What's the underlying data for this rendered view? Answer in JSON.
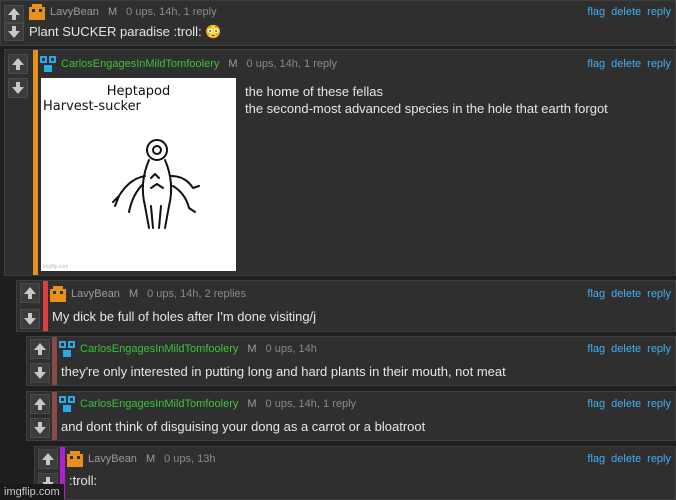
{
  "actions": {
    "flag": "flag",
    "delete": "delete",
    "reply": "reply"
  },
  "comments": [
    {
      "user": "LavyBean",
      "mod": "M",
      "meta": "0 ups, 14h, 1 reply",
      "text": "Plant SUCKER paradise :troll: 😳"
    },
    {
      "user": "CarlosEngagesInMildTomfoolery",
      "mod": "M",
      "meta": "0 ups, 14h, 1 reply",
      "line1": "the home of these fellas",
      "line2": "the second-most advanced species in the hole that earth forgot",
      "meme_title_1": "Heptapod",
      "meme_title_2": "Harvest-sucker"
    },
    {
      "user": "LavyBean",
      "mod": "M",
      "meta": "0 ups, 14h, 2 replies",
      "text": "My dick be full of holes after I'm done visiting/j"
    },
    {
      "user": "CarlosEngagesInMildTomfoolery",
      "mod": "M",
      "meta": "0 ups, 14h",
      "text": "they're only interested in putting long and hard plants in their mouth, not meat"
    },
    {
      "user": "CarlosEngagesInMildTomfoolery",
      "mod": "M",
      "meta": "0 ups, 14h, 1 reply",
      "text": "and dont think of disguising your dong as a carrot or a bloatroot"
    },
    {
      "user": "LavyBean",
      "mod": "M",
      "meta": "0 ups, 13h",
      "text": ":troll:"
    }
  ],
  "watermark": "imgflip.com",
  "colors": {
    "accent_link": "#44aef0",
    "green_user": "#3cc23c",
    "stripe_orange": "#e8901c",
    "stripe_red": "#d94040",
    "stripe_brown": "#8b4a4a",
    "stripe_purple": "#b020d0"
  }
}
